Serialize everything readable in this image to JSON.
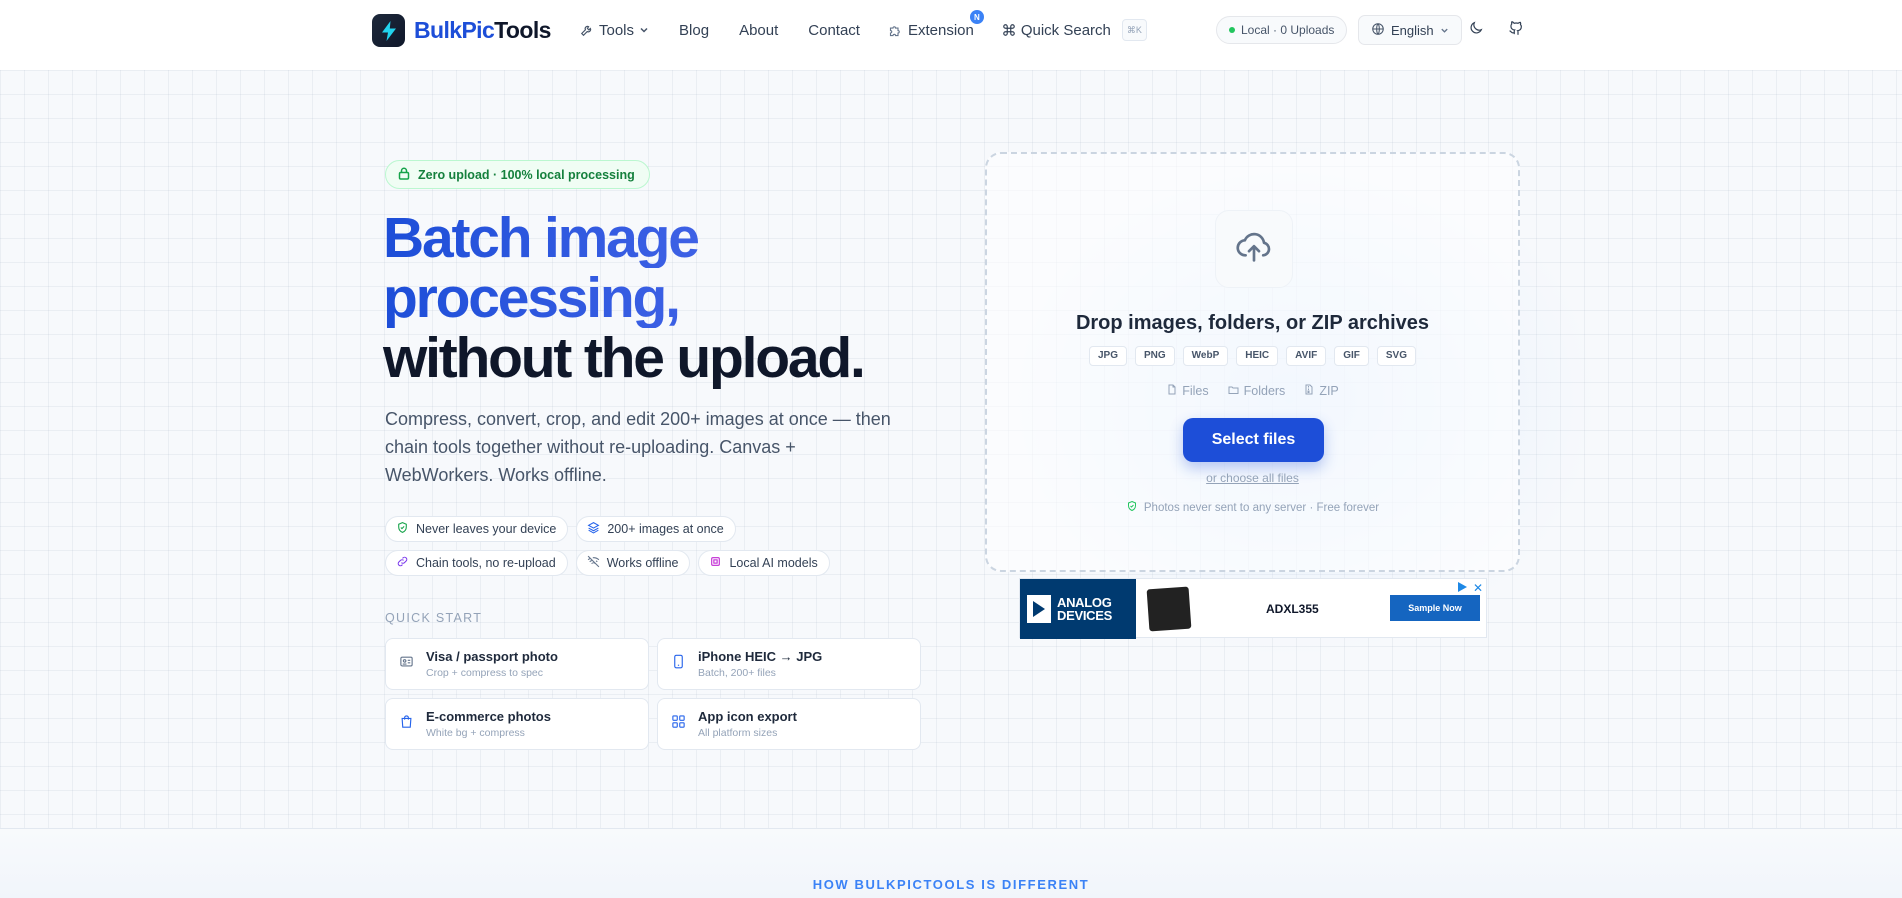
{
  "header": {
    "logo": {
      "part1": "BulkPic",
      "part2": "Tools"
    },
    "nav": {
      "tools": "Tools",
      "blog": "Blog",
      "about": "About",
      "contact": "Contact",
      "extension": "Extension",
      "extension_badge": "N",
      "quick_search": "Quick Search",
      "quick_search_kbd": "⌘K"
    },
    "status": "Local · 0 Uploads",
    "language": "English"
  },
  "hero": {
    "pill": "Zero upload · 100% local processing",
    "headline": {
      "line1": "Batch image",
      "line2": "processing,",
      "line3": "without the upload."
    },
    "subtitle": "Compress, convert, crop, and edit 200+ images at once — then chain tools together without re-uploading. Canvas + WebWorkers. Works offline.",
    "chips": [
      {
        "label": "Never leaves your device",
        "icon": "shield-check-icon"
      },
      {
        "label": "200+ images at once",
        "icon": "layers-icon"
      },
      {
        "label": "Chain tools, no re-upload",
        "icon": "link-icon"
      },
      {
        "label": "Works offline",
        "icon": "wifi-off-icon"
      },
      {
        "label": "Local AI models",
        "icon": "cpu-icon"
      }
    ],
    "quick_start": {
      "label": "QUICK START",
      "cards": [
        {
          "title": "Visa / passport photo",
          "desc": "Crop + compress to spec",
          "icon": "id-card-icon"
        },
        {
          "title": "iPhone HEIC → JPG",
          "desc": "Batch, 200+ files",
          "icon": "phone-icon"
        },
        {
          "title": "E-commerce photos",
          "desc": "White bg + compress",
          "icon": "shopping-bag-icon"
        },
        {
          "title": "App icon export",
          "desc": "All platform sizes",
          "icon": "grid-icon"
        }
      ]
    }
  },
  "dropzone": {
    "title": "Drop images, folders, or ZIP archives",
    "formats": [
      "JPG",
      "PNG",
      "WebP",
      "HEIC",
      "AVIF",
      "GIF",
      "SVG"
    ],
    "kinds": [
      {
        "label": "Files",
        "icon": "file-icon"
      },
      {
        "label": "Folders",
        "icon": "folder-icon"
      },
      {
        "label": "ZIP",
        "icon": "zip-icon"
      }
    ],
    "select_button": "Select files",
    "choose_all": "or choose all files",
    "privacy": "Photos never sent to any server · Free forever"
  },
  "ad": {
    "brand_line1": "ANALOG",
    "brand_line2": "DEVICES",
    "model": "ADXL355",
    "cta": "Sample Now",
    "close": "✕"
  },
  "section": {
    "how": "HOW BULKPICTOOLS IS DIFFERENT"
  },
  "colors": {
    "primary": "#1d4ed8",
    "success": "#15803d",
    "text": "#0f172a",
    "muted": "#94a3b8"
  }
}
